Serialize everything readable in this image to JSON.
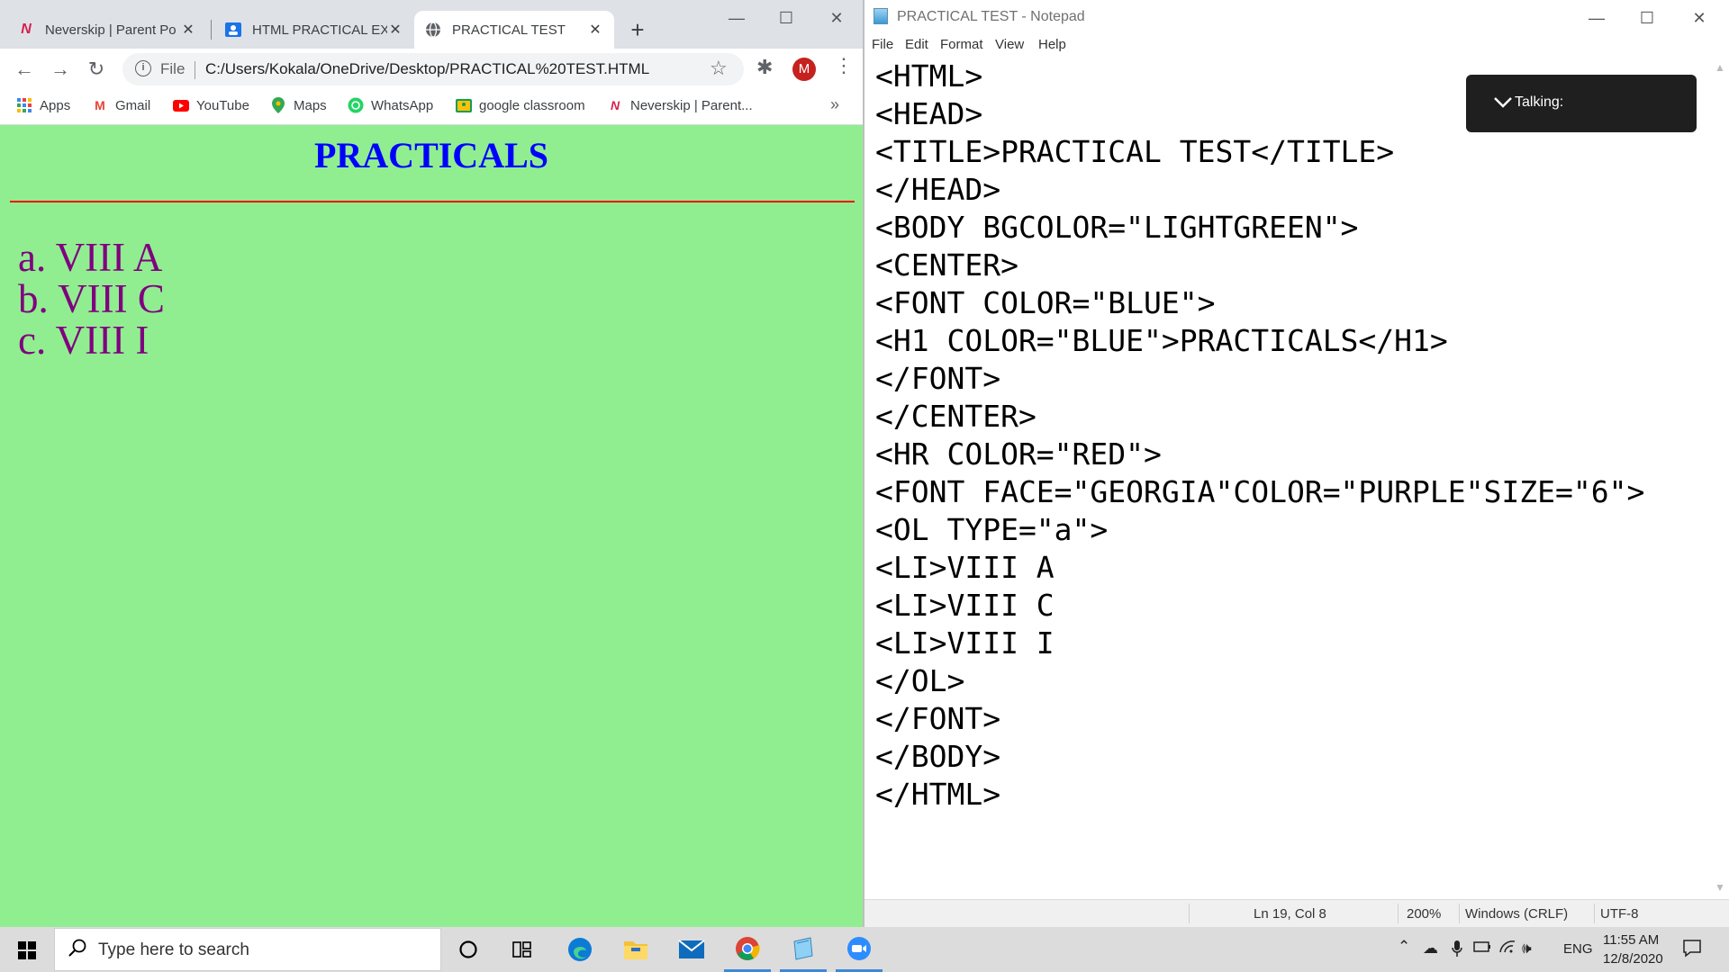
{
  "chrome": {
    "tabs": [
      {
        "label": "Neverskip | Parent Po",
        "icon": "neverskip-icon"
      },
      {
        "label": "HTML PRACTICAL EX",
        "icon": "classroom-icon"
      },
      {
        "label": "PRACTICAL TEST",
        "icon": "globe-icon"
      }
    ],
    "address": {
      "scheme_label": "File",
      "url": "C:/Users/Kokala/OneDrive/Desktop/PRACTICAL%20TEST.HTML"
    },
    "profile_initial": "M",
    "bookmarks": [
      {
        "label": "Apps",
        "icon": "apps-grid-icon"
      },
      {
        "label": "Gmail",
        "icon": "gmail-icon"
      },
      {
        "label": "YouTube",
        "icon": "youtube-icon"
      },
      {
        "label": "Maps",
        "icon": "maps-icon"
      },
      {
        "label": "WhatsApp",
        "icon": "whatsapp-icon"
      },
      {
        "label": "google classroom",
        "icon": "classroom-icon"
      },
      {
        "label": "Neverskip | Parent...",
        "icon": "neverskip-icon"
      }
    ],
    "bookmarks_more": "»"
  },
  "page": {
    "heading": "PRACTICALS",
    "list": [
      "a. VIII A",
      "b. VIII C",
      "c. VIII I"
    ],
    "colors": {
      "background": "#90ee90",
      "heading": "#0000ff",
      "rule": "#ff0000",
      "list": "#800080"
    }
  },
  "notepad": {
    "title": "PRACTICAL TEST - Notepad",
    "menu": [
      "File",
      "Edit",
      "Format",
      "View",
      "Help"
    ],
    "lines": [
      "<HTML>",
      "<HEAD>",
      "<TITLE>PRACTICAL TEST</TITLE>",
      "</HEAD>",
      "<BODY BGCOLOR=\"LIGHTGREEN\">",
      "<CENTER>",
      "<FONT COLOR=\"BLUE\">",
      "<H1 COLOR=\"BLUE\">PRACTICALS</H1>",
      "</FONT>",
      "</CENTER>",
      "<HR COLOR=\"RED\">",
      "<FONT FACE=\"GEORGIA\"COLOR=\"PURPLE\"SIZE=\"6\">",
      "<OL TYPE=\"a\">",
      "<LI>VIII A",
      "<LI>VIII C",
      "<LI>VIII I",
      "</OL>",
      "</FONT>",
      "</BODY>",
      "</HTML>"
    ],
    "status": {
      "position": "Ln 19, Col 8",
      "zoom": "200%",
      "line_ending": "Windows (CRLF)",
      "encoding": "UTF-8"
    }
  },
  "talking_popup": {
    "label": "Talking:"
  },
  "taskbar": {
    "search_placeholder": "Type here to search",
    "apps": [
      "cortana-icon",
      "task-view-icon",
      "edge-icon",
      "file-explorer-icon",
      "mail-icon",
      "chrome-icon",
      "notepad-icon",
      "zoom-icon"
    ],
    "tray": {
      "language": "ENG",
      "time": "11:55 AM",
      "date": "12/8/2020"
    }
  }
}
